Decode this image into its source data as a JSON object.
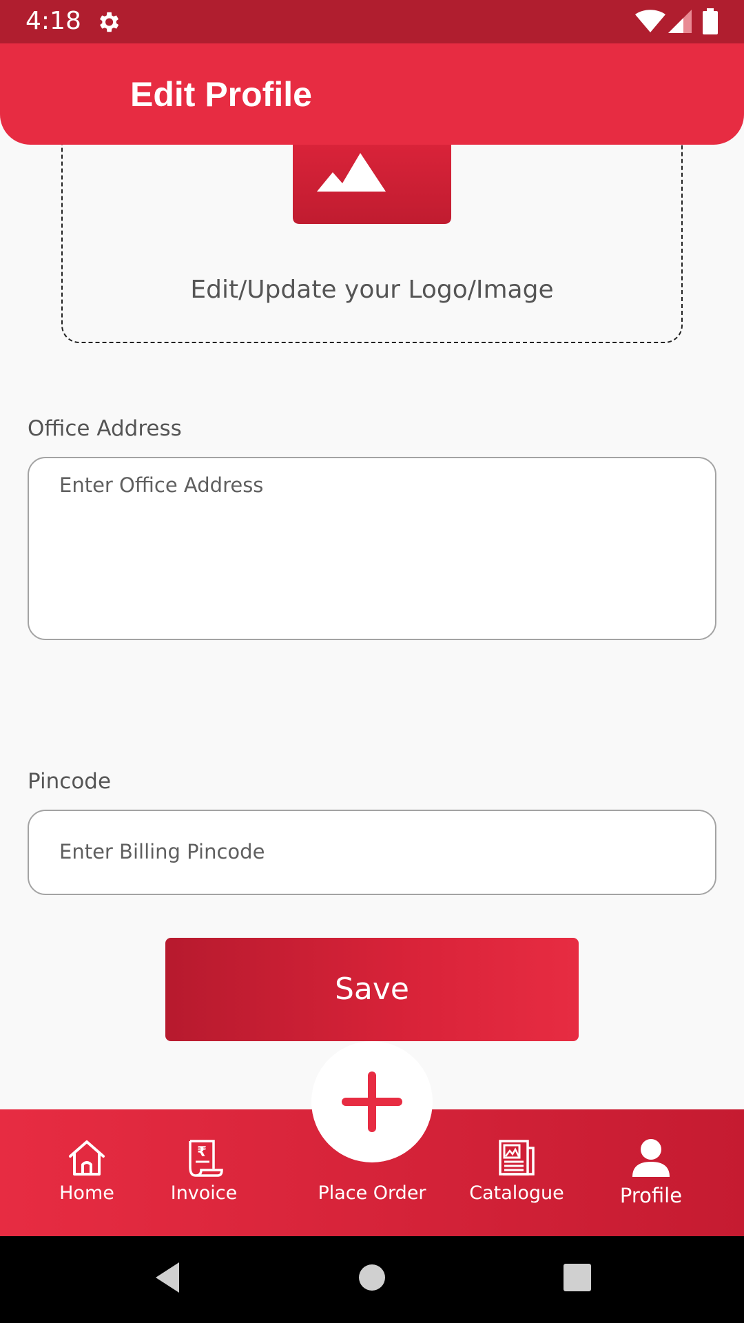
{
  "status_bar": {
    "time": "4:18"
  },
  "header": {
    "title": "Edit Profile"
  },
  "logo_card": {
    "caption": "Edit/Update your Logo/Image"
  },
  "form": {
    "office_address": {
      "label": "Office Address",
      "placeholder": "Enter Office Address",
      "value": ""
    },
    "pincode": {
      "label": "Pincode",
      "placeholder": "Enter Billing Pincode",
      "value": ""
    }
  },
  "save_button": {
    "label": "Save"
  },
  "bottom_nav": {
    "items": [
      {
        "label": "Home",
        "icon": "home-icon"
      },
      {
        "label": "Invoice",
        "icon": "invoice-icon"
      },
      {
        "label": "Place Order",
        "icon": "plus-icon"
      },
      {
        "label": "Catalogue",
        "icon": "catalogue-icon"
      },
      {
        "label": "Profile",
        "icon": "profile-icon",
        "active": true
      }
    ]
  },
  "colors": {
    "primary": "#e72c42",
    "status_bar": "#b01e2f",
    "background": "#f9f9f9"
  }
}
